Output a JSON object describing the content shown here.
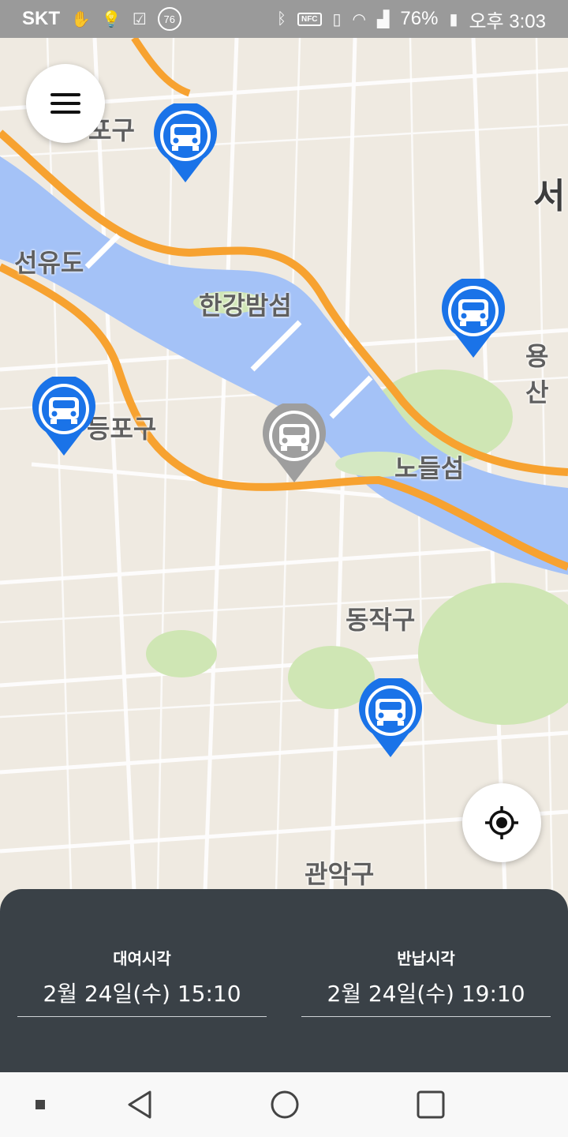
{
  "status_bar": {
    "carrier": "SKT",
    "notification_badge": "76",
    "nfc_label": "NFC",
    "battery": "76%",
    "time": "오후 3:03"
  },
  "map": {
    "labels": {
      "mapo": "포구",
      "seo": "서",
      "seonyudo": "선유도",
      "hangang_bamseom": "한강밤섬",
      "yongsan": "용산",
      "yeongdeungpo": "등포구",
      "nodeulseom": "노들섬",
      "dongjak": "동작구",
      "gwanak": "관악구"
    },
    "colors": {
      "river": "#a4c2f7",
      "highway": "#f7a230",
      "park": "#cfe6b4",
      "land": "#efeae1"
    }
  },
  "pins": [
    {
      "id": "car-pin-1",
      "state": "active",
      "color": "#1a73e8",
      "icon": "car-icon"
    },
    {
      "id": "car-pin-2",
      "state": "active",
      "color": "#1a73e8",
      "icon": "car-icon"
    },
    {
      "id": "car-pin-3",
      "state": "active",
      "color": "#1a73e8",
      "icon": "car-icon"
    },
    {
      "id": "car-pin-4",
      "state": "inactive",
      "color": "#9e9e9e",
      "icon": "car-icon"
    },
    {
      "id": "car-pin-5",
      "state": "active",
      "color": "#1a73e8",
      "icon": "car-icon"
    }
  ],
  "controls": {
    "menu_icon": "hamburger-menu-icon",
    "locate_icon": "my-location-icon"
  },
  "panel": {
    "rental": {
      "label": "대여시각",
      "value": "2월 24일(수) 15:10"
    },
    "return": {
      "label": "반납시각",
      "value": "2월 24일(수) 19:10"
    },
    "background": "#3a4147"
  },
  "nav": {
    "buttons": [
      "menu-dot-icon",
      "back-icon",
      "home-icon",
      "recents-icon"
    ]
  }
}
